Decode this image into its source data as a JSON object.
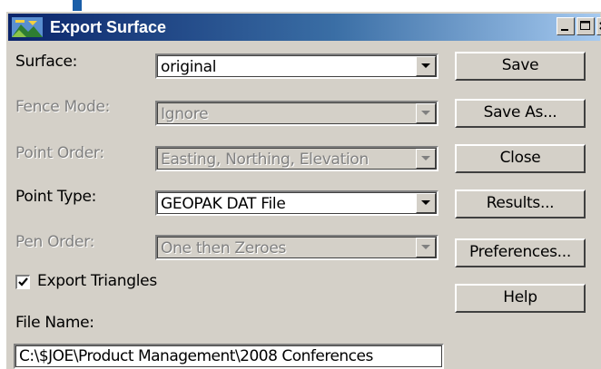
{
  "window": {
    "title": "Export Surface"
  },
  "fields": {
    "surface": {
      "label": "Surface:",
      "value": "original"
    },
    "fence_mode": {
      "label": "Fence Mode:",
      "value": "Ignore"
    },
    "point_order": {
      "label": "Point Order:",
      "value": "Easting, Northing, Elevation"
    },
    "point_type": {
      "label": "Point Type:",
      "value": "GEOPAK DAT File"
    },
    "pen_order": {
      "label": "Pen Order:",
      "value": "One then Zeroes"
    }
  },
  "export_triangles": {
    "label": "Export Triangles",
    "checked": true
  },
  "file_name": {
    "label": "File Name:",
    "value": "C:\\$JOE\\Product Management\\2008 Conferences"
  },
  "buttons": {
    "save": "Save",
    "save_as": "Save As...",
    "close": "Close",
    "results": "Results...",
    "preferences": "Preferences...",
    "help": "Help"
  }
}
